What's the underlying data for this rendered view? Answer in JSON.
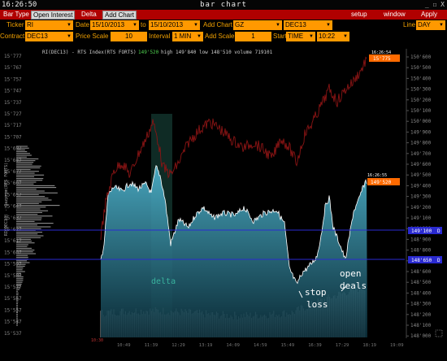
{
  "window": {
    "clock": "16:26:50",
    "title": "bar chart",
    "controls": "_ ☐ X"
  },
  "menu": {
    "bar_type": "Bar Type",
    "open_interest": "Open Interest",
    "delta": "Delta",
    "add_chart": "Add Chart",
    "setup": "setup",
    "window": "window",
    "apply": "Apply"
  },
  "row1": {
    "ticker_label": "Ticker",
    "ticker": "RI",
    "date_label": "Date",
    "date_from": "15/10/2013",
    "to_label": "to",
    "date_to": "15/10/2013",
    "add_chart_label": "Add Chart",
    "add_chart_value": "GZ",
    "contract2": "DEC13",
    "line_label": "Line",
    "line_value": "DAY"
  },
  "row2": {
    "contract_label": "Contract",
    "contract": "DEC13",
    "price_scale_label": "Price Scale",
    "price_scale": "10",
    "interval_label": "Interval",
    "interval": "1 MIN",
    "add_scale_label": "Add Scale",
    "add_scale": "1",
    "start_label": "Start",
    "start_type": "TIME",
    "start_time": "10:22"
  },
  "chart": {
    "header": "RI(DEC13) - RTS Index(RTS FORTS)",
    "header_last": "149'520",
    "header_rest": "high 149'840  low 148'510  volume 719101",
    "vertical_label": "RI(DEC13) - Gazprom(RTS FORTS)",
    "right_ticks": [
      "150'600",
      "150'500",
      "150'400",
      "150'300",
      "150'200",
      "150'100",
      "150'000",
      "149'900",
      "149'800",
      "149'700",
      "149'600",
      "149'500",
      "149'400",
      "149'300",
      "149'200",
      "149'100",
      "149'000",
      "148'900",
      "148'800",
      "148'700",
      "148'600",
      "148'500",
      "148'400",
      "148'300",
      "148'200",
      "148'100",
      "148'000"
    ],
    "left_ticks": [
      "15'777",
      "15'767",
      "15'757",
      "15'747",
      "15'737",
      "15'727",
      "15'717",
      "15'707",
      "15'697",
      "15'687",
      "15'677",
      "15'667",
      "15'657",
      "15'647",
      "15'637",
      "15'627",
      "15'617",
      "15'607",
      "15'597",
      "15'587",
      "15'577",
      "15'567",
      "15'557",
      "15'547",
      "15'537"
    ],
    "x_ticks": [
      "10:49",
      "11:39",
      "12:29",
      "13:19",
      "14:09",
      "14:59",
      "15:49",
      "16:39",
      "17:29",
      "18:19",
      "19:09"
    ],
    "left_marker": "10:30",
    "tag_gz_time": "16:26:54",
    "tag_gz_value": "15'775",
    "tag_ri_time": "16:26:55",
    "tag_ri_value": "149'520",
    "level1": "149'100",
    "level2": "148'650",
    "level_suffix": "D",
    "annotations": {
      "delta": "delta",
      "stop": "stop",
      "loss": "loss",
      "open": "open",
      "deals": "deals"
    },
    "colors": {
      "ri_fill": "#3a9bb8",
      "gz_line": "#7a1010",
      "level": "#2a2ad0",
      "tag": "#ff6a00"
    }
  }
}
